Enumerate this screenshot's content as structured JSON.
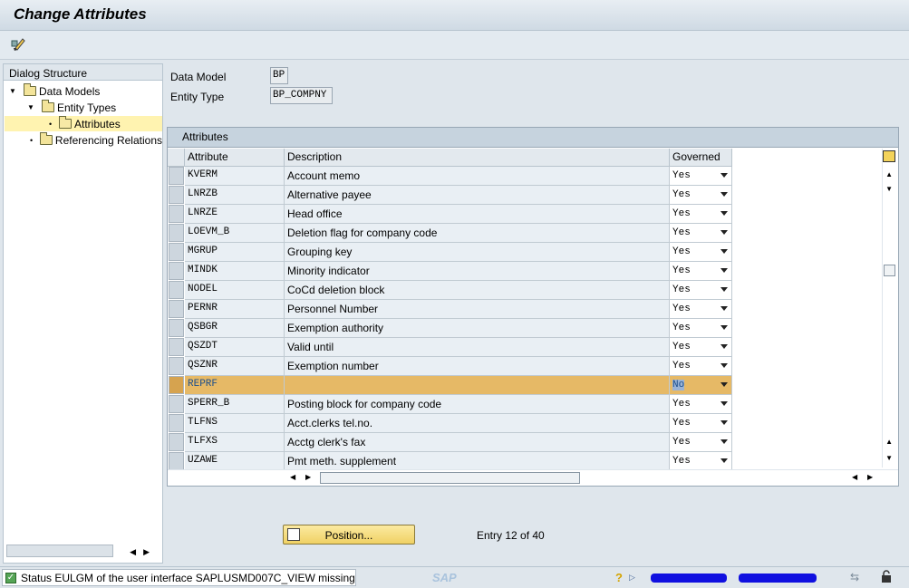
{
  "window": {
    "title": "Change Attributes"
  },
  "toolbar": {
    "icons": [
      "edit-toggle-icon"
    ]
  },
  "dialog_structure": {
    "header": "Dialog Structure",
    "items": [
      {
        "label": "Data Models",
        "level": 0,
        "expanded": true
      },
      {
        "label": "Entity Types",
        "level": 1,
        "expanded": true
      },
      {
        "label": "Attributes",
        "level": 2,
        "selected": true
      },
      {
        "label": "Referencing Relations",
        "level": 1
      }
    ]
  },
  "fields": {
    "data_model_label": "Data Model",
    "data_model_value": "BP",
    "entity_type_label": "Entity Type",
    "entity_type_value": "BP_COMPNY"
  },
  "table": {
    "title": "Attributes",
    "columns": [
      "Attribute",
      "Description",
      "Governed"
    ],
    "rows": [
      {
        "attribute": "KVERM",
        "description": "Account memo",
        "governed": "Yes"
      },
      {
        "attribute": "LNRZB",
        "description": "Alternative payee",
        "governed": "Yes"
      },
      {
        "attribute": "LNRZE",
        "description": "Head office",
        "governed": "Yes"
      },
      {
        "attribute": "LOEVM_B",
        "description": "Deletion flag for company code",
        "governed": "Yes"
      },
      {
        "attribute": "MGRUP",
        "description": "Grouping key",
        "governed": "Yes"
      },
      {
        "attribute": "MINDK",
        "description": "Minority indicator",
        "governed": "Yes"
      },
      {
        "attribute": "NODEL",
        "description": "CoCd deletion block",
        "governed": "Yes"
      },
      {
        "attribute": "PERNR",
        "description": "Personnel Number",
        "governed": "Yes"
      },
      {
        "attribute": "QSBGR",
        "description": "Exemption authority",
        "governed": "Yes"
      },
      {
        "attribute": "QSZDT",
        "description": "Valid until",
        "governed": "Yes"
      },
      {
        "attribute": "QSZNR",
        "description": "Exemption number",
        "governed": "Yes"
      },
      {
        "attribute": "REPRF",
        "description": "",
        "governed": "No",
        "selected": true
      },
      {
        "attribute": "SPERR_B",
        "description": "Posting block for company code",
        "governed": "Yes"
      },
      {
        "attribute": "TLFNS",
        "description": "Acct.clerks tel.no.",
        "governed": "Yes"
      },
      {
        "attribute": "TLFXS",
        "description": "Acctg clerk's fax",
        "governed": "Yes"
      },
      {
        "attribute": "UZAWE",
        "description": "Pmt meth. supplement",
        "governed": "Yes"
      }
    ]
  },
  "footer": {
    "position_button": "Position...",
    "entry_text": "Entry 12 of 40"
  },
  "statusbar": {
    "message": "Status EULGM of the user interface SAPLUSMD007C_VIEW missing",
    "logo": "SAP"
  }
}
